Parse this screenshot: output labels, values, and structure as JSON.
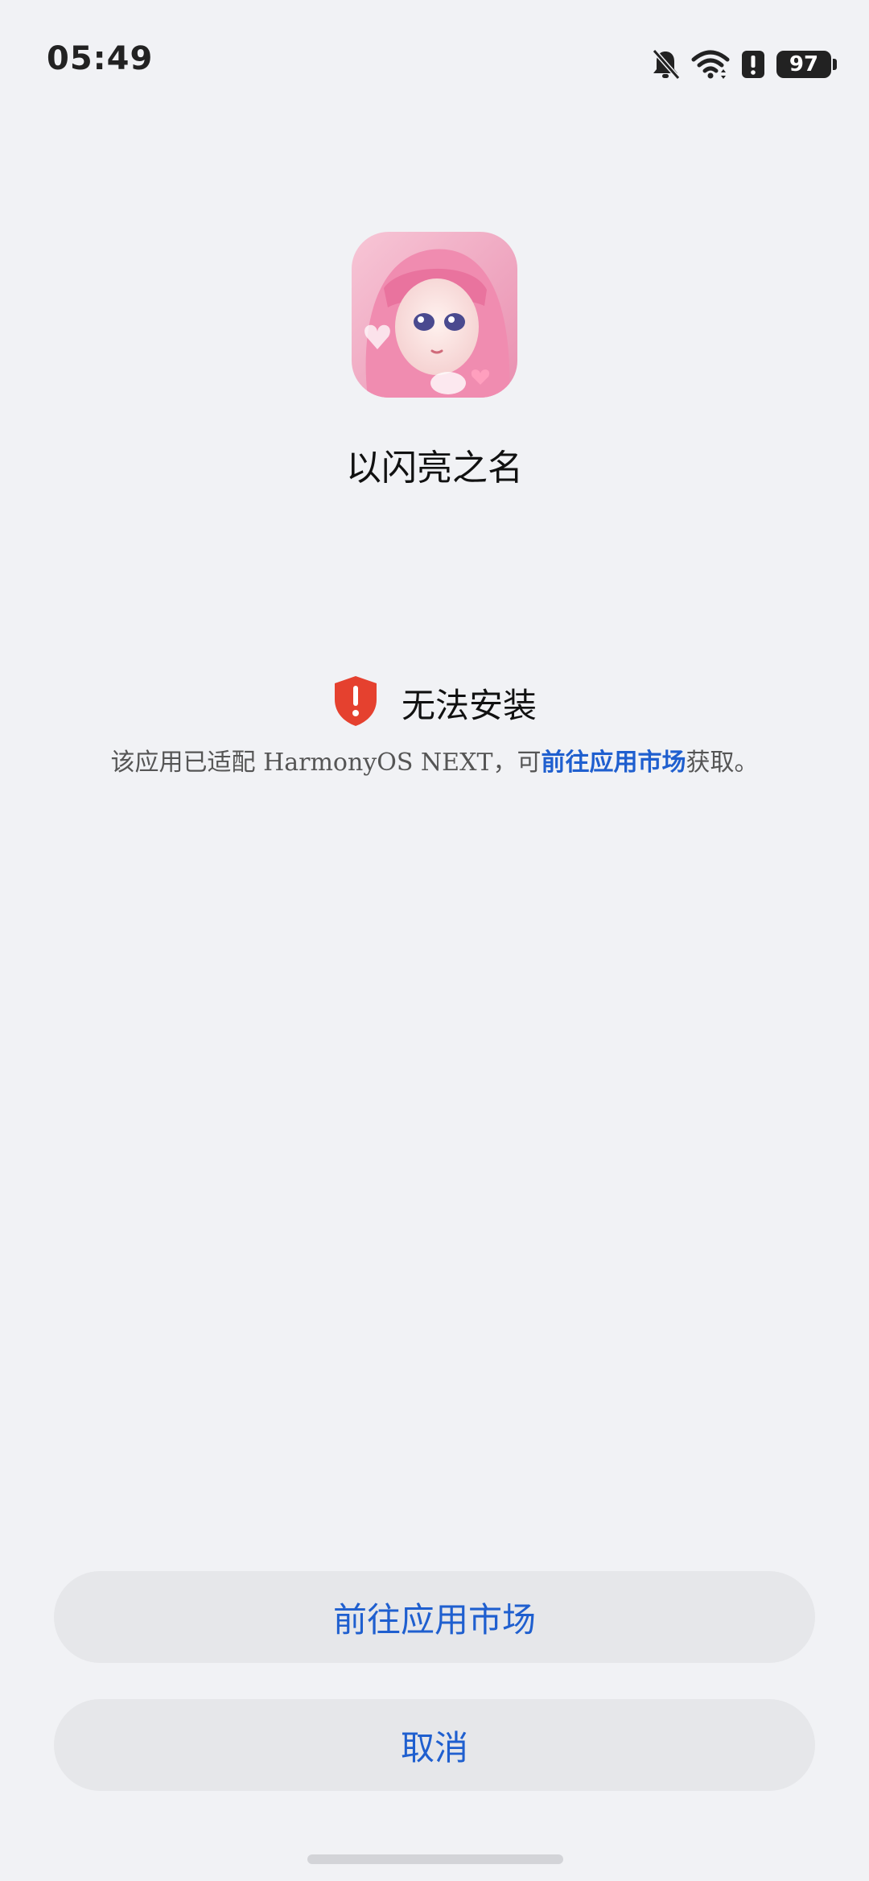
{
  "status_bar": {
    "time": "05:49",
    "icons": [
      "bell-off-icon",
      "wifi-icon",
      "alert-icon"
    ],
    "battery": "97"
  },
  "app": {
    "name": "以闪亮之名",
    "icon": "app-icon-anime-girl-portrait"
  },
  "warning": {
    "icon": "shield-alert-icon",
    "title": "无法安装",
    "desc_prefix": "该应用已适配 HarmonyOS NEXT，可",
    "desc_link": "前往应用市场",
    "desc_suffix": "获取。"
  },
  "buttons": {
    "market": "前往应用市场",
    "cancel": "取消"
  },
  "colors": {
    "background": "#f1f2f5",
    "accent": "#1f5fcf",
    "warning": "#e5412f",
    "button_bg": "#e6e7ea"
  }
}
